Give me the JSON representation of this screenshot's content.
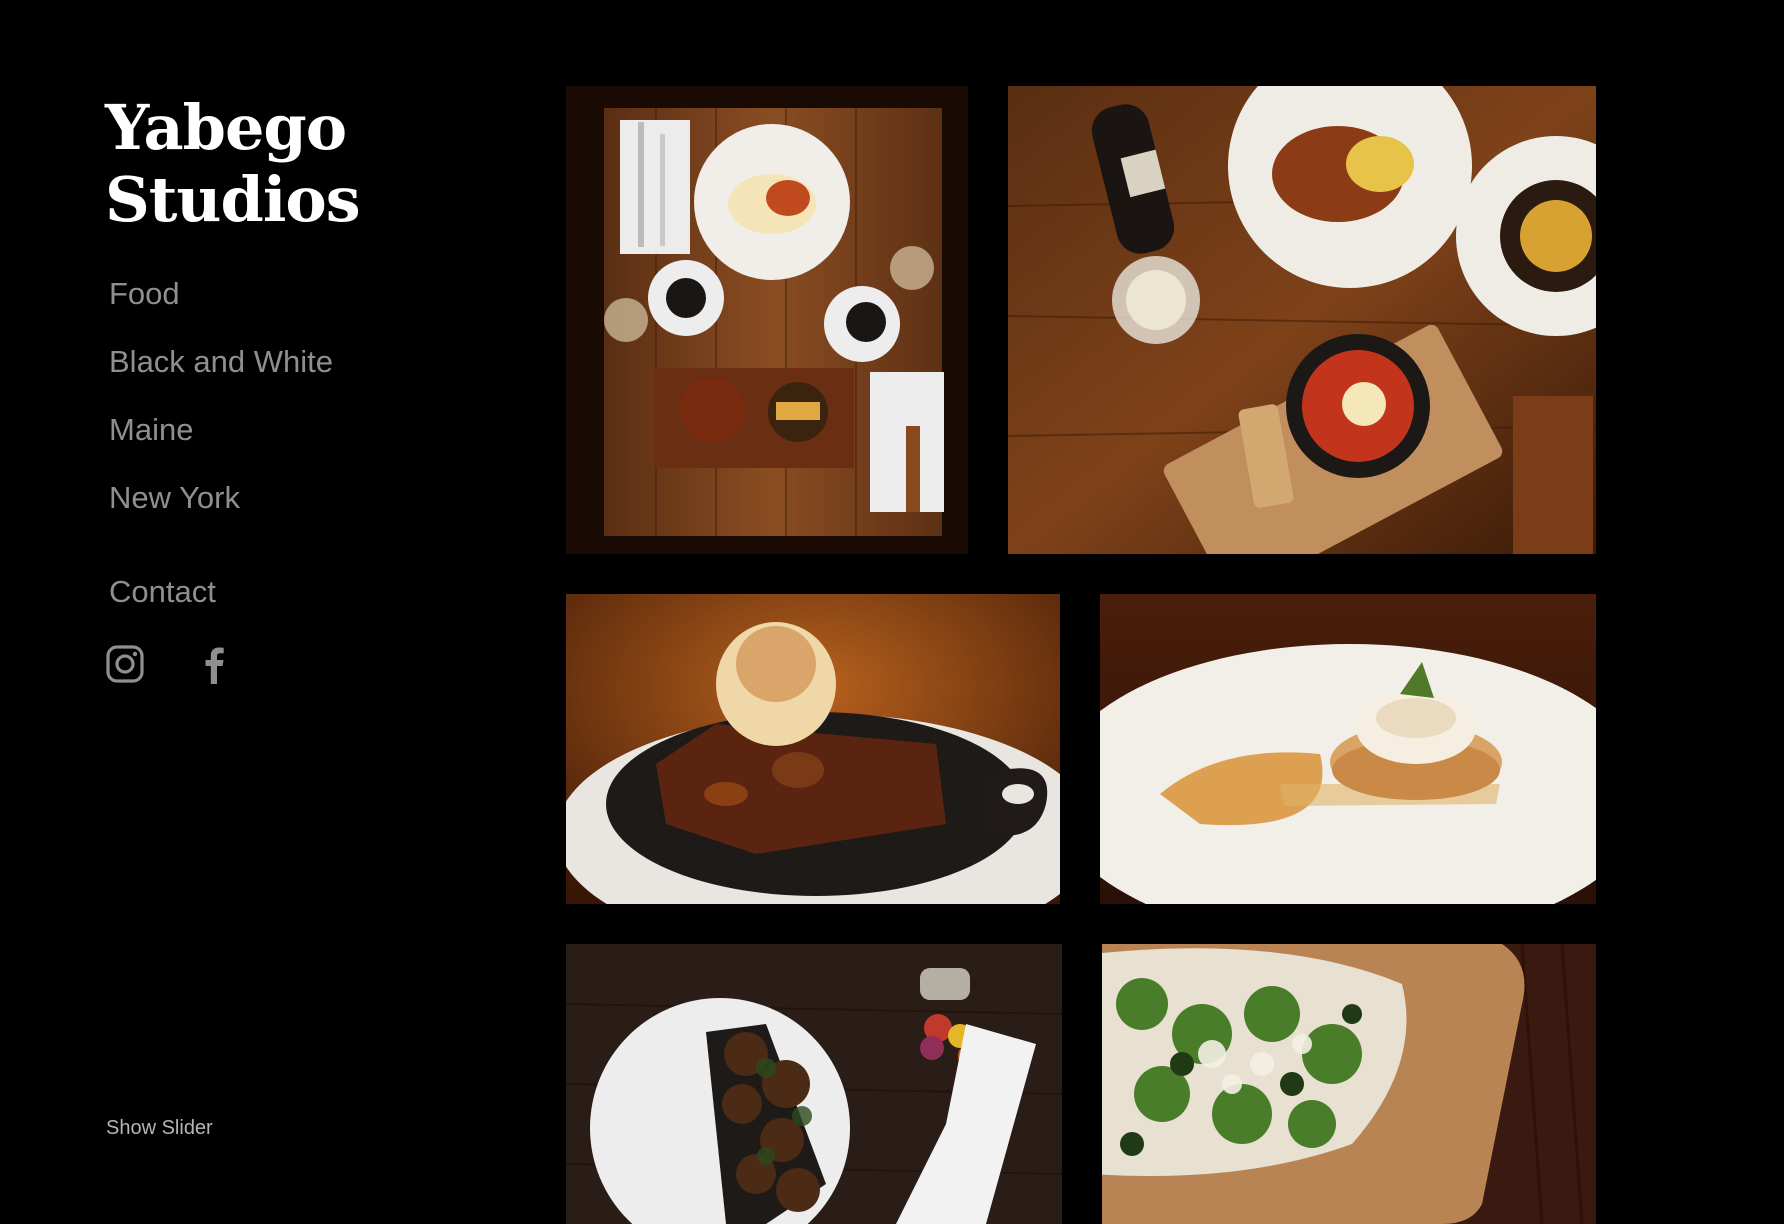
{
  "site": {
    "title_line1": "Yabego",
    "title_line2": "Studios"
  },
  "nav": {
    "items": [
      {
        "label": "Food"
      },
      {
        "label": "Black and White"
      },
      {
        "label": "Maine"
      },
      {
        "label": "New York"
      }
    ],
    "contact": "Contact"
  },
  "social": {
    "icons": [
      "instagram-icon",
      "facebook-icon"
    ]
  },
  "footer": {
    "show_slider": "Show Slider"
  },
  "gallery": {
    "images": [
      {
        "name": "breakfast-table-photo"
      },
      {
        "name": "brunch-wine-photo"
      },
      {
        "name": "brownie-sundae-photo"
      },
      {
        "name": "meringue-tart-photo"
      },
      {
        "name": "brussels-sprouts-photo"
      },
      {
        "name": "arugula-flatbread-photo"
      }
    ]
  },
  "colors": {
    "background": "#000000",
    "title": "#ffffff",
    "nav_text": "#8f8f8f",
    "footer_text": "#b5b5b5"
  }
}
